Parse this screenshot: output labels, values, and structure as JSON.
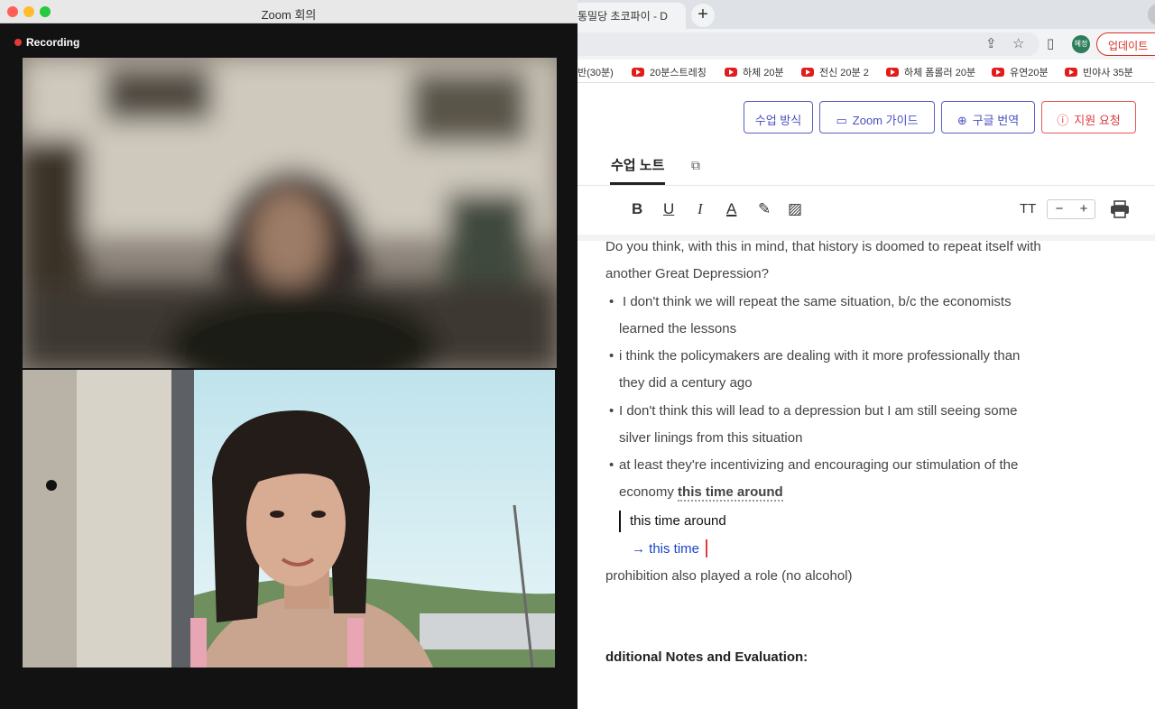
{
  "zoom": {
    "title": "Zoom 회의",
    "recording_label": "Recording",
    "traffic_lights": {
      "close": "#ff5f57",
      "minimize": "#febc2e",
      "zoom": "#28c840"
    }
  },
  "browser": {
    "tab_title": "통밀당 초코파이 - D",
    "new_tab_label": "+",
    "profile_avatar": "혜정",
    "update_button": "업데이트",
    "icons": [
      "share-icon",
      "star-icon",
      "sidebar-icon"
    ],
    "bookmarks": [
      {
        "label": "반(30분)"
      },
      {
        "label": "20분스트레칭"
      },
      {
        "label": "하체 20분"
      },
      {
        "label": "전신 20분 2"
      },
      {
        "label": "하체 폼롤러 20분"
      },
      {
        "label": "유연20분"
      },
      {
        "label": "빈야사 35분"
      }
    ]
  },
  "actions": {
    "class_method": "수업 방식",
    "zoom_guide": "Zoom 가이드",
    "google_translate": "구글 번역",
    "support_request": "지원 요청"
  },
  "notes": {
    "tab_label": "수업 노트",
    "toolbar": {
      "bold": "B",
      "underline": "U",
      "italic": "I",
      "text_color": "A",
      "font_size": "TT",
      "decrease": "−",
      "increase": "+"
    },
    "lines": {
      "q1": "Do you think, with this in mind, that history is doomed to repeat itself with",
      "q2": "another Great Depression?",
      "b1a": "I don't think we will repeat the same situation, b/c the economists",
      "b1b": "learned the lessons",
      "b2a": "i think the policymakers are dealing with it more professionally than",
      "b2b": "they did a century ago",
      "b3a": "I don't think this will lead to a depression but I am still seeing some",
      "b3b": "silver linings from this situation",
      "b4a": "at least they're incentivizing and encouraging our stimulation of the",
      "b4b_prefix": "economy",
      "b4b_highlight": "this time around",
      "quote": "this time around",
      "correction": "→ this time",
      "after": "prohibition also played a role (no alcohol)"
    },
    "bullet_char": "•",
    "section_heading": "dditional Notes and Evaluation:"
  },
  "colors": {
    "accent": "#5b5fc7",
    "danger": "#e0393e",
    "correction_blue": "#1a45c9"
  }
}
